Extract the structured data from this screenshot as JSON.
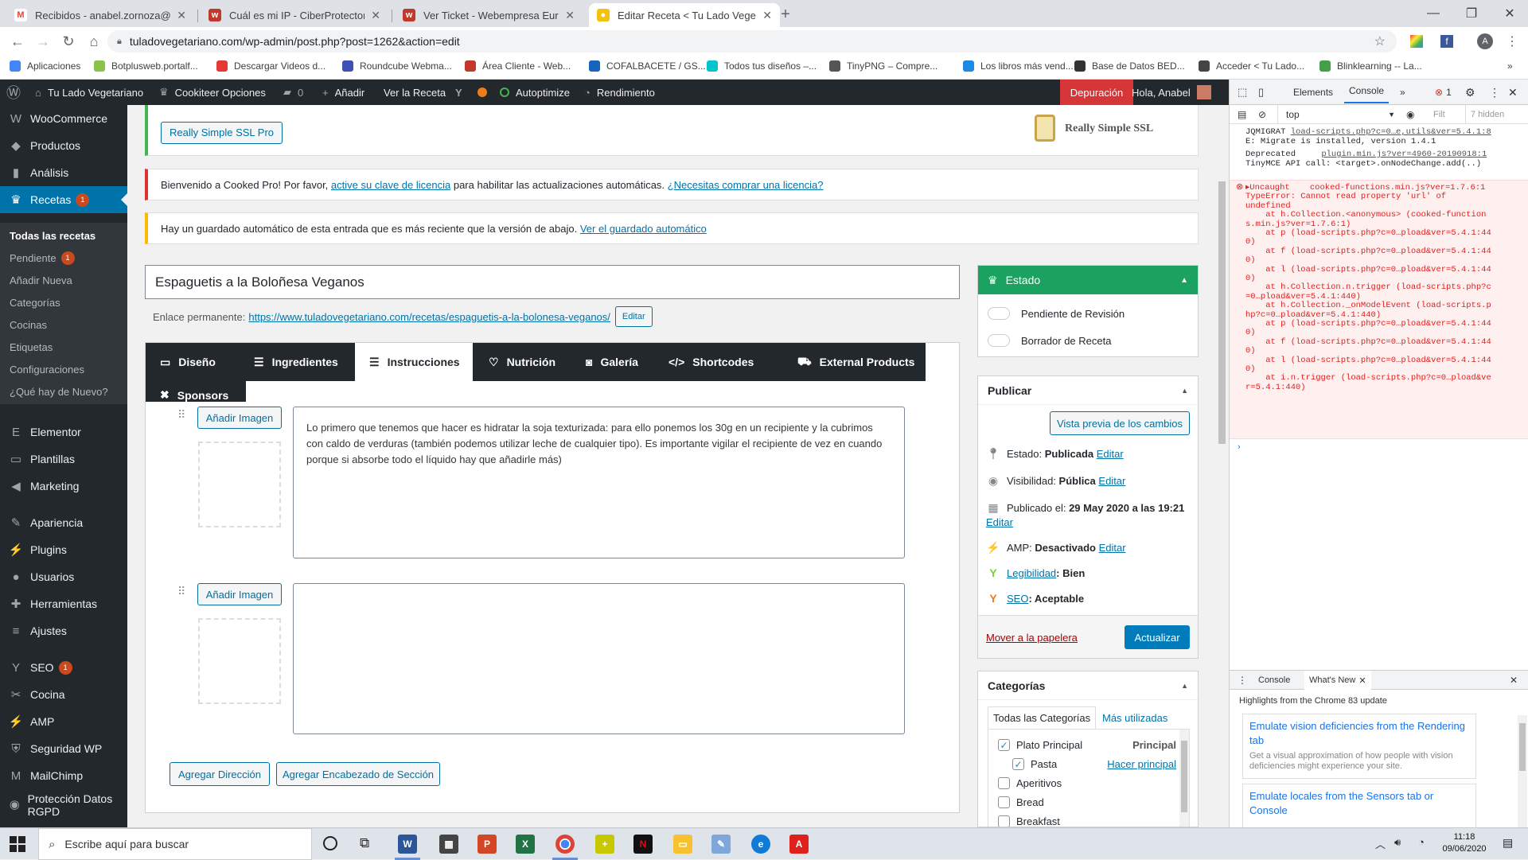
{
  "browser": {
    "tabs": [
      {
        "title": "Recibidos - anabel.zornoza@gm",
        "icon": "gmail-icon",
        "color": "#ea4335",
        "glyph": "M"
      },
      {
        "title": "Cuál es mi IP - CiberProtector",
        "icon": "webempresa-icon",
        "color": "#c0392b",
        "glyph": "w"
      },
      {
        "title": "Ver Ticket - Webempresa Europa",
        "icon": "webempresa-icon",
        "color": "#c0392b",
        "glyph": "w"
      },
      {
        "title": "Editar Receta < Tu Lado Vegetari",
        "icon": "lemon-icon",
        "color": "#f4c20d",
        "glyph": "●"
      }
    ],
    "url": "tuladovegetariano.com/wp-admin/post.php?post=1262&action=edit",
    "bookmarks": [
      {
        "label": "Aplicaciones",
        "color": "#4285f4"
      },
      {
        "label": "Botplusweb.portalf...",
        "color": "#8bc34a"
      },
      {
        "label": "Descargar Videos d...",
        "color": "#e53935"
      },
      {
        "label": "Roundcube Webma...",
        "color": "#3f51b5"
      },
      {
        "label": "Área Cliente - Web...",
        "color": "#c0392b"
      },
      {
        "label": "COFALBACETE / GS...",
        "color": "#1565c0"
      },
      {
        "label": "Todos tus diseños –...",
        "color": "#00c4cc"
      },
      {
        "label": "TinyPNG – Compre...",
        "color": "#555555"
      },
      {
        "label": "Los libros más vend...",
        "color": "#1e88e5"
      },
      {
        "label": "Base de Datos BED...",
        "color": "#333333"
      },
      {
        "label": "Acceder < Tu Lado...",
        "color": "#444444"
      },
      {
        "label": "Blinklearning -- La...",
        "color": "#43a047"
      }
    ]
  },
  "adminbar": {
    "site": "Tu Lado Vegetariano",
    "cookiteer": "Cookiteer Opciones",
    "comments": "0",
    "add": "Añadir",
    "view": "Ver la Receta",
    "autoptimize": "Autoptimize",
    "rendimiento": "Rendimiento",
    "debug": "Depuración",
    "greeting": "Hola, Anabel"
  },
  "sidebar": {
    "items": [
      {
        "label": "WooCommerce",
        "icon": "woocommerce-icon",
        "glyph": "W"
      },
      {
        "label": "Productos",
        "icon": "box-icon",
        "glyph": "◆"
      },
      {
        "label": "Análisis",
        "icon": "bar-chart-icon",
        "glyph": "▮"
      },
      {
        "label": "Recetas",
        "icon": "chef-hat-icon",
        "glyph": "♛",
        "badge": "1"
      },
      {
        "label": "Elementor",
        "icon": "elementor-icon",
        "glyph": "E"
      },
      {
        "label": "Plantillas",
        "icon": "folder-icon",
        "glyph": "▭"
      },
      {
        "label": "Marketing",
        "icon": "megaphone-icon",
        "glyph": "◀"
      },
      {
        "label": "Apariencia",
        "icon": "brush-icon",
        "glyph": "✎"
      },
      {
        "label": "Plugins",
        "icon": "plug-icon",
        "glyph": "⚡"
      },
      {
        "label": "Usuarios",
        "icon": "user-icon",
        "glyph": "●"
      },
      {
        "label": "Herramientas",
        "icon": "wrench-icon",
        "glyph": "✚"
      },
      {
        "label": "Ajustes",
        "icon": "settings-icon",
        "glyph": "≡"
      },
      {
        "label": "SEO",
        "icon": "yoast-icon",
        "glyph": "Y",
        "badge": "1"
      },
      {
        "label": "Cocina",
        "icon": "utensils-icon",
        "glyph": "✂"
      },
      {
        "label": "AMP",
        "icon": "amp-icon",
        "glyph": "⚡"
      },
      {
        "label": "Seguridad WP",
        "icon": "shield-icon",
        "glyph": "⛨"
      },
      {
        "label": "MailChimp",
        "icon": "mailchimp-icon",
        "glyph": "M"
      },
      {
        "label": "Protección Datos RGPD",
        "icon": "eye-icon",
        "glyph": "◉"
      }
    ],
    "submenu": [
      {
        "label": "Todas las recetas"
      },
      {
        "label": "Pendiente",
        "badge": "1"
      },
      {
        "label": "Añadir Nueva"
      },
      {
        "label": "Categorías"
      },
      {
        "label": "Cocinas"
      },
      {
        "label": "Etiquetas"
      },
      {
        "label": "Configuraciones"
      },
      {
        "label": "¿Qué hay de Nuevo?"
      }
    ]
  },
  "notices": {
    "ssl_button": "Really Simple SSL Pro",
    "ssl_brand": "Really Simple SSL",
    "cooked_prefix": "Bienvenido a Cooked Pro!",
    "cooked_mid": " Por favor, ",
    "cooked_link1": "active su clave de licencia",
    "cooked_mid2": " para habilitar las actualizaciones automáticas. ",
    "cooked_link2": "¿Necesitas comprar una licencia?",
    "autosave_text": "Hay un guardado automático de esta entrada que es más reciente que la versión de abajo. ",
    "autosave_link": "Ver el guardado automático"
  },
  "post": {
    "title": "Espaguetis a la Boloñesa Veganos",
    "permalink_label": "Enlace permanente:",
    "permalink_url": "https://www.tuladovegetariano.com/recetas/espaguetis-a-la-bolonesa-veganos/",
    "edit": "Editar"
  },
  "recipe_tabs": [
    {
      "label": "Diseño",
      "icon": "monitor-icon",
      "glyph": "▭"
    },
    {
      "label": "Ingredientes",
      "icon": "list-icon",
      "glyph": "☰"
    },
    {
      "label": "Instrucciones",
      "icon": "list-ordered-icon",
      "glyph": "☰"
    },
    {
      "label": "Nutrición",
      "icon": "heart-icon",
      "glyph": "♡"
    },
    {
      "label": "Galería",
      "icon": "camera-icon",
      "glyph": "◙"
    },
    {
      "label": "Shortcodes",
      "icon": "code-icon",
      "glyph": "</>"
    },
    {
      "label": "External Products",
      "icon": "cart-icon",
      "glyph": "⛟"
    },
    {
      "label": "Sponsors",
      "icon": "tools-icon",
      "glyph": "✖"
    }
  ],
  "instructions": {
    "add_image": "Añadir Imagen",
    "step1": "Lo primero que tenemos que hacer es hidratar la soja texturizada: para ello ponemos los 30g en un recipiente y la cubrimos con caldo de verduras (también podemos utilizar leche de cualquier tipo). Es importante vigilar el recipiente de vez en cuando porque si absorbe todo el líquido hay que añadirle más)",
    "step2": "",
    "add_direction": "Agregar Dirección",
    "add_section": "Agregar Encabezado de Sección"
  },
  "estado": {
    "title": "Estado",
    "pending": "Pendiente de Revisión",
    "draft": "Borrador de Receta"
  },
  "publish": {
    "title": "Publicar",
    "preview": "Vista previa de los cambios",
    "status_label": "Estado: ",
    "status_value": "Publicada",
    "visibility_label": "Visibilidad: ",
    "visibility_value": "Pública",
    "published_label": "Publicado el: ",
    "published_value": "29 May 2020 a las 19:21",
    "amp_label": "AMP: ",
    "amp_value": "Desactivado",
    "readability_label": "Legibilidad",
    "readability_value": ": Bien",
    "seo_label": "SEO",
    "seo_value": ": Aceptable",
    "edit": "Editar",
    "trash": "Mover a la papelera",
    "update": "Actualizar"
  },
  "categories": {
    "title": "Categorías",
    "tab_all": "Todas las Categorías",
    "tab_used": "Más utilizadas",
    "items": [
      {
        "label": "Plato Principal",
        "checked": true,
        "indent": false,
        "right": "Principal"
      },
      {
        "label": "Pasta",
        "checked": true,
        "indent": true,
        "right": "Hacer principal"
      },
      {
        "label": "Aperitivos",
        "checked": false,
        "indent": false,
        "right": ""
      },
      {
        "label": "Bread",
        "checked": false,
        "indent": false,
        "right": ""
      },
      {
        "label": "Breakfast",
        "checked": false,
        "indent": false,
        "right": ""
      }
    ]
  },
  "devtools": {
    "tabs": [
      "Elements",
      "Console"
    ],
    "error_count": "1",
    "context": "top",
    "filter": "Filt",
    "hidden": "7 hidden",
    "logs": [
      {
        "text": "JQMIGRAT ",
        "link": "load-scripts.php?c=0…e,utils&ver=5.4.1:8",
        "type": "log"
      },
      {
        "text": "E: Migrate is installed, version 1.4.1",
        "link": "",
        "type": "log"
      },
      {
        "text": "Deprecated ",
        "link": "plugin.min.js?ver=4960-20190918:1",
        "type": "log"
      },
      {
        "text": "TinyMCE API call: <target>.onNodeChange.add(..)",
        "link": "",
        "type": "log"
      }
    ],
    "error": [
      "▸Uncaught    cooked-functions.min.js?ver=1.7.6:1",
      "TypeError: Cannot read property 'url' of",
      "undefined",
      "    at h.Collection.<anonymous> (cooked-function",
      "s.min.js?ver=1.7.6:1)",
      "    at p (load-scripts.php?c=0…pload&ver=5.4.1:44",
      "0)",
      "    at f (load-scripts.php?c=0…pload&ver=5.4.1:44",
      "0)",
      "    at l (load-scripts.php?c=0…pload&ver=5.4.1:44",
      "0)",
      "    at h.Collection.n.trigger (load-scripts.php?c",
      "=0…pload&ver=5.4.1:440)",
      "    at h.Collection._onModelEvent (load-scripts.p",
      "hp?c=0…pload&ver=5.4.1:440)",
      "    at p (load-scripts.php?c=0…pload&ver=5.4.1:44",
      "0)",
      "    at f (load-scripts.php?c=0…pload&ver=5.4.1:44",
      "0)",
      "    at l (load-scripts.php?c=0…pload&ver=5.4.1:44",
      "0)",
      "    at i.n.trigger (load-scripts.php?c=0…pload&ve",
      "r=5.4.1:440)"
    ],
    "drawer_tabs": [
      "Console",
      "What's New"
    ],
    "highlights": "Highlights from the Chrome 83 update",
    "card1_title": "Emulate vision deficiencies from the Rendering tab",
    "card1_desc": "Get a visual approximation of how people with vision deficiencies might experience your site.",
    "card2_title": "Emulate locales from the Sensors tab or Console"
  },
  "taskbar": {
    "search": "Escribe aquí para buscar",
    "time": "11:18",
    "date": "09/06/2020"
  }
}
